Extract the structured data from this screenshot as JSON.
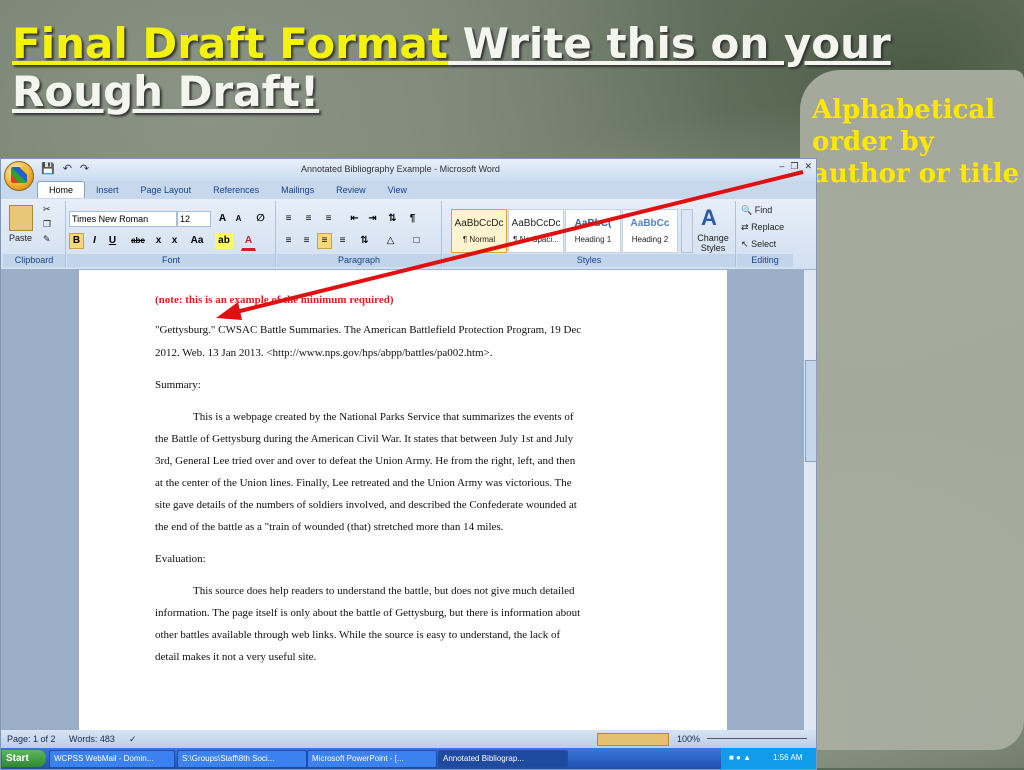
{
  "slide": {
    "title_part1": "Final Draft Format",
    "title_part2": " Write this on your Rough Draft!",
    "side_note": "Alphabetical order by author or title"
  },
  "window": {
    "doc_title": "Annotated Bibliography Example - Microsoft Word",
    "tabs": [
      "Home",
      "Insert",
      "Page Layout",
      "References",
      "Mailings",
      "Review",
      "View"
    ]
  },
  "ribbon": {
    "clipboard": {
      "paste": "Paste",
      "label": "Clipboard"
    },
    "font": {
      "name": "Times New Roman",
      "size": "12",
      "label": "Font"
    },
    "paragraph": {
      "label": "Paragraph"
    },
    "styles": {
      "label": "Styles",
      "change": "Change Styles",
      "items": [
        {
          "sample": "AaBbCcDc",
          "name": "¶ Normal"
        },
        {
          "sample": "AaBbCcDc",
          "name": "¶ No Spaci..."
        },
        {
          "sample": "AaBbC(",
          "name": "Heading 1"
        },
        {
          "sample": "AaBbCc",
          "name": "Heading 2"
        }
      ]
    },
    "editing": {
      "find": "Find",
      "replace": "Replace",
      "select": "Select",
      "label": "Editing"
    }
  },
  "document": {
    "note": "(note: this is an example of the minimum required)",
    "citation_line1": "\"Gettysburg.\" CWSAC Battle Summaries. The American Battlefield Protection Program,  19 Dec",
    "citation_line2": "2012.   Web. 13 Jan 2013. <http://www.nps.gov/hps/abpp/battles/pa002.htm>.",
    "summary_heading": "Summary:",
    "summary_lines": [
      "This is a webpage created by the National Parks Service that summarizes the events of",
      "the Battle of Gettysburg during the American Civil War.  It states that between July 1st and July",
      "3rd, General Lee tried over and over to defeat the Union Army.  He from the right, left, and then",
      "at the center of the Union lines.  Finally,  Lee retreated and the Union Army was victorious.  The",
      "site gave details of the numbers of soldiers involved, and described the Confederate wounded at",
      "the end of the battle as a  \"train of wounded (that) stretched more than 14 miles."
    ],
    "evaluation_heading": "Evaluation:",
    "evaluation_lines": [
      "This source does help readers to understand the battle, but does not give much detailed",
      "information.  The page itself is only about the battle of Gettysburg, but there is information about",
      "other battles available through web links.  While the source is easy to understand, the lack of",
      "detail makes it not a very useful site."
    ]
  },
  "statusbar": {
    "page": "Page: 1 of 2",
    "words": "Words: 483",
    "zoom": "100%"
  },
  "taskbar": {
    "start": "Start",
    "items": [
      "WCPSS WebMail - Domin...",
      "S:\\Groups\\Staff\\8th Soci...",
      "Microsoft PowerPoint - [...",
      "Annotated Bibliograp..."
    ],
    "clock": "1:56 AM"
  }
}
